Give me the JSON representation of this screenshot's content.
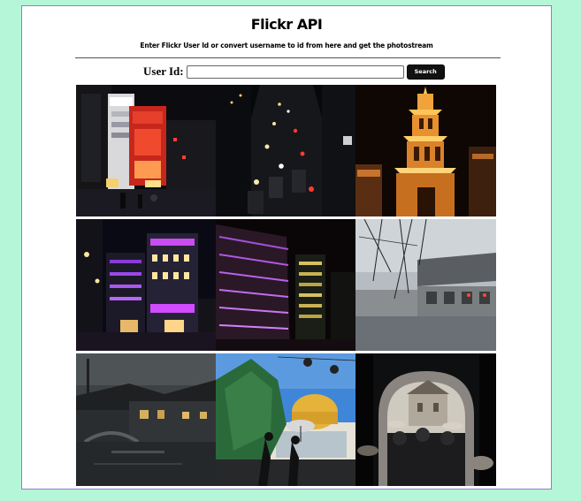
{
  "header": {
    "title": "Flickr API",
    "subtitle": "Enter Flickr User Id or convert username to id from here and get the photostream"
  },
  "search": {
    "label": "User Id:",
    "value": "",
    "placeholder": "",
    "button_label": "Search"
  },
  "colors": {
    "page_background": "#b5f5d8",
    "panel_border": "#8a7fd6",
    "button_background": "#111111"
  },
  "photos": [
    {
      "alt": "night street with illuminated storefronts"
    },
    {
      "alt": "night street traffic seen from above"
    },
    {
      "alt": "illuminated pagoda tower at night"
    },
    {
      "alt": "shopping street with purple neon lights"
    },
    {
      "alt": "modern buildings with lights at night"
    },
    {
      "alt": "rainy old riverside houses"
    },
    {
      "alt": "canal town houses at dusk"
    },
    {
      "alt": "golden dome and tree silhouettes"
    },
    {
      "alt": "stone archway with crowd"
    }
  ]
}
